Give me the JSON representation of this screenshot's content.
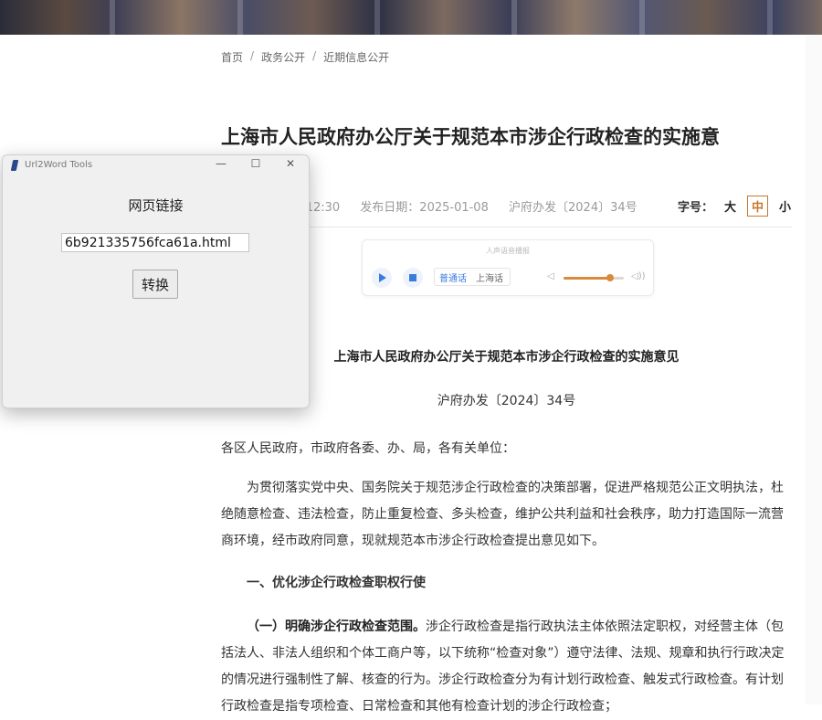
{
  "breadcrumb": {
    "items": [
      "首页",
      "政务公开",
      "近期信息公开"
    ],
    "separator": "/"
  },
  "article": {
    "title": "上海市人民政府办公厅关于规范本市涉企行政检查的实施意",
    "meta": {
      "time": "-12:30",
      "publish_date": "发布日期：2025-01-08",
      "doc_no": "沪府办发〔2024〕34号"
    },
    "font_size": {
      "label": "字号：",
      "options": [
        "大",
        "中",
        "小"
      ],
      "active": "中"
    }
  },
  "player": {
    "hint": "人声语音播报",
    "voices": [
      "普通话",
      "上海话"
    ],
    "volume_fraction": 0.78,
    "play_icon": "play-icon",
    "stop_icon": "stop-icon",
    "volume_low_icon": "volume-low-icon",
    "volume_high_icon": "volume-high-icon",
    "accent_color": "#3a7be0",
    "slider_color": "#d9893b"
  },
  "doc": {
    "title": "上海市人民政府办公厅关于规范本市涉企行政检查的实施意见",
    "number": "沪府办发〔2024〕34号",
    "salutation": "各区人民政府，市政府各委、办、局，各有关单位：",
    "intro": "为贯彻落实党中央、国务院关于规范涉企行政检查的决策部署，促进严格规范公正文明执法，杜绝随意检查、违法检查，防止重复检查、多头检查，维护公共利益和社会秩序，助力打造国际一流营商环境，经市政府同意，现就规范本市涉企行政检查提出意见如下。",
    "section1": "一、优化涉企行政检查职权行使",
    "sub1_heading": "（一）明确涉企行政检查范围。",
    "sub1_body": "涉企行政检查是指行政执法主体依照法定职权，对经营主体（包括法人、非法人组织和个体工商户等，以下统称“检查对象”）遵守法律、法规、规章和执行行政决定的情况进行强制性了解、核查的行为。涉企行政检查分为有计划行政检查、触发式行政检查。有计划行政检查是指专项检查、日常检查和其他有检查计划的涉企行政检查；"
  },
  "tool_window": {
    "title": "Url2Word Tools",
    "app_icon": "app-feather-icon",
    "controls": {
      "minimize": "—",
      "maximize": "☐",
      "close": "✕"
    },
    "label": "网页链接",
    "url_value": "6b921335756fca61a.html",
    "convert_label": "转换"
  }
}
